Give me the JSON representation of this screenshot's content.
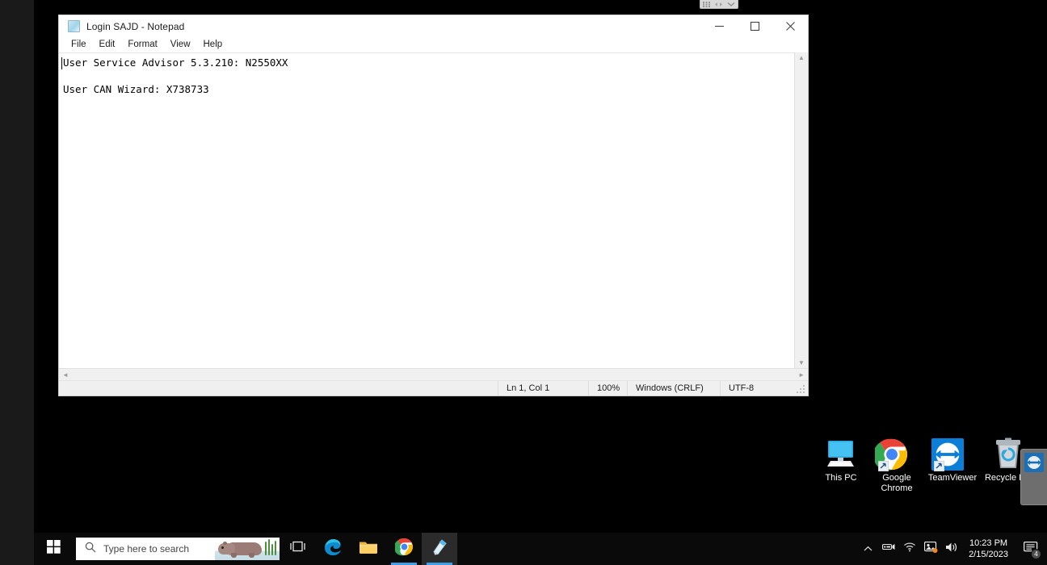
{
  "remote_toolbar": {
    "icons": [
      "grid-icon",
      "resize-icon",
      "chevron-down-icon"
    ]
  },
  "notepad": {
    "title": "Login SAJD - Notepad",
    "icon": "notepad-icon",
    "menus": [
      "File",
      "Edit",
      "Format",
      "View",
      "Help"
    ],
    "window_controls": {
      "minimize": "minimize-icon",
      "maximize": "maximize-icon",
      "close": "close-icon"
    },
    "document_lines": [
      "User Service Advisor 5.3.210: N2550XX",
      "",
      "User CAN Wizard: X738733"
    ],
    "statusbar": {
      "position": "Ln 1, Col 1",
      "zoom": "100%",
      "line_ending": "Windows (CRLF)",
      "encoding": "UTF-8"
    },
    "scroll": {
      "up": "▲",
      "down": "▼",
      "left": "◄",
      "right": "►"
    }
  },
  "desktop": {
    "icons": [
      {
        "name": "this-pc",
        "label": "This PC"
      },
      {
        "name": "google-chrome",
        "label": "Google\nChrome"
      },
      {
        "name": "teamviewer",
        "label": "TeamViewer"
      },
      {
        "name": "recycle-bin",
        "label": "Recycle Bin"
      }
    ],
    "background_color": "#000000"
  },
  "taskbar": {
    "start": "windows-logo-icon",
    "search": {
      "placeholder": "Type here to search",
      "icon": "search-icon",
      "image": "hippo-illustration"
    },
    "buttons": [
      {
        "name": "task-view",
        "icon": "task-view-icon",
        "active": false
      },
      {
        "name": "microsoft-edge",
        "icon": "edge-icon",
        "active": false
      },
      {
        "name": "file-explorer",
        "icon": "folder-icon",
        "active": false
      },
      {
        "name": "google-chrome",
        "icon": "chrome-icon",
        "active": false
      },
      {
        "name": "notepad",
        "icon": "notepad-icon",
        "active": true
      }
    ],
    "tray": [
      {
        "name": "show-hidden-icons",
        "icon": "chevron-up-icon"
      },
      {
        "name": "remote-device",
        "icon": "device-icon"
      },
      {
        "name": "network",
        "icon": "wifi-icon"
      },
      {
        "name": "display-settings",
        "icon": "display-icon"
      },
      {
        "name": "volume",
        "icon": "speaker-icon"
      }
    ],
    "clock": {
      "time": "10:23 PM",
      "date": "2/15/2023"
    },
    "action_center": {
      "icon": "notification-icon",
      "badge": "4"
    }
  },
  "colors": {
    "accent": "#3aa0e8",
    "taskbar": "#0a0a0a",
    "desktop": "#000000",
    "window": "#ffffff"
  }
}
